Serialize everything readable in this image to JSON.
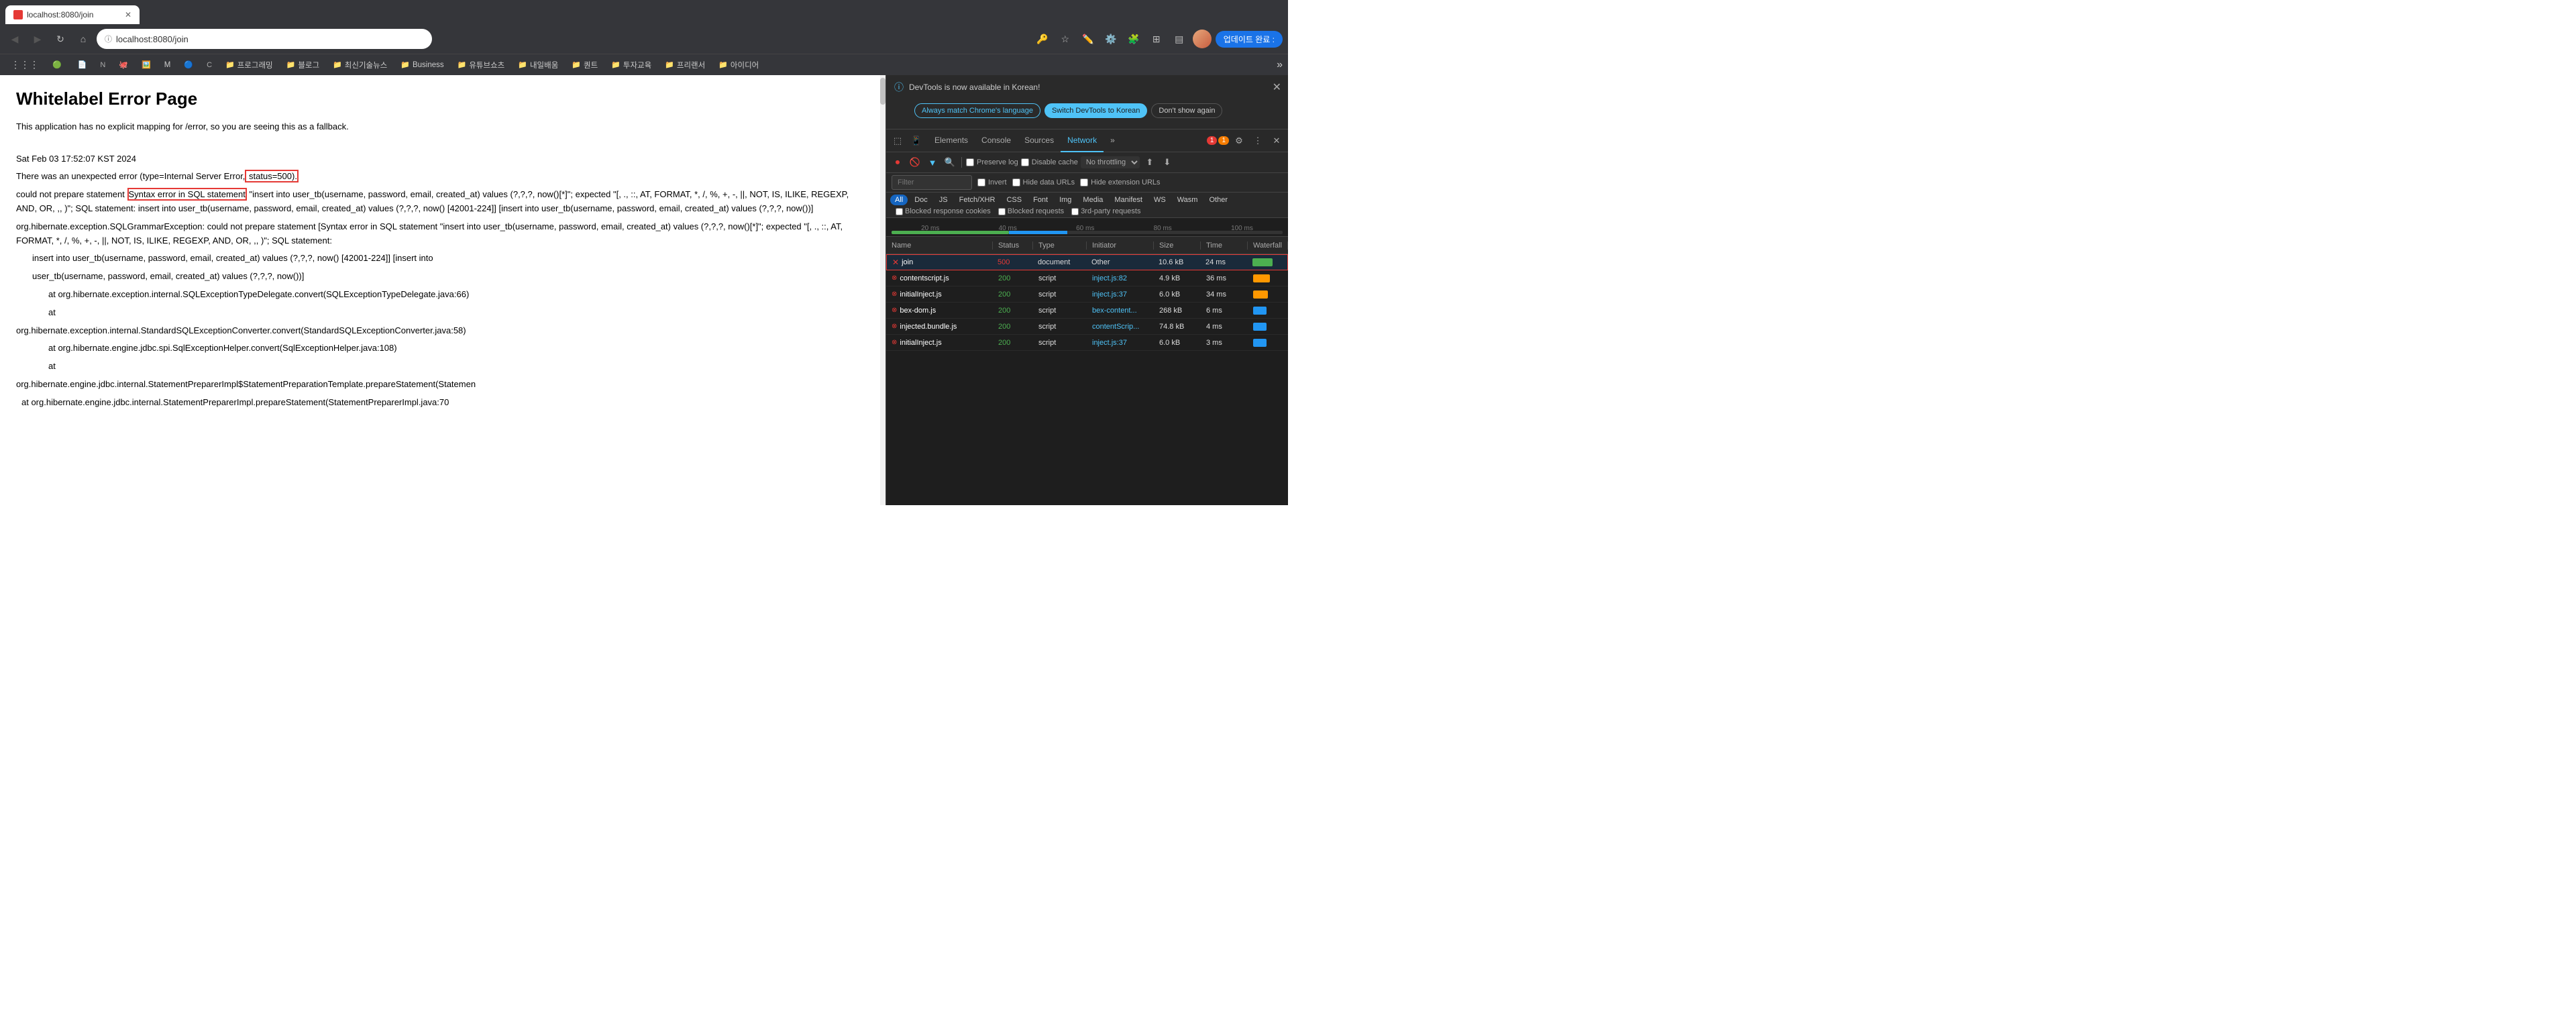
{
  "browser": {
    "address": "localhost:8080/join",
    "tab_title": "localhost:8080/join",
    "update_btn": "업데이트 완료 :",
    "nav": {
      "back": "←",
      "forward": "→",
      "reload": "↺",
      "home": "⌂"
    }
  },
  "bookmarks": [
    {
      "label": "프로그래밍",
      "icon": "📁"
    },
    {
      "label": "블로그",
      "icon": "📁"
    },
    {
      "label": "최신기술뉴스",
      "icon": "📁"
    },
    {
      "label": "Business",
      "icon": "📁"
    },
    {
      "label": "유튜브쇼츠",
      "icon": "📁"
    },
    {
      "label": "내일배움",
      "icon": "📁"
    },
    {
      "label": "퀀트",
      "icon": "📁"
    },
    {
      "label": "투자교육",
      "icon": "📁"
    },
    {
      "label": "프리랜서",
      "icon": "📁"
    },
    {
      "label": "아이디어",
      "icon": "📁"
    }
  ],
  "page": {
    "title": "Whitelabel Error Page",
    "paragraph1": "This application has no explicit mapping for /error, so you are seeing this as a fallback.",
    "line1": "Sat Feb 03 17:52:07 KST 2024",
    "line2_prefix": "There was an unexpected error (type=Internal Server Error,",
    "line2_suffix": " status=500).",
    "line3": "could not prepare statement [Syntax error in SQL statement \"insert into user_tb(username, password, email, created_at) values (?,?,?, now()[*]\"; expected \"[, ., ::, AT, FORMAT, *, /, %, +, -, ||, NOT, IS, ILIKE, REGEXP, AND, OR, ,, )\"; SQL statement: insert into user_tb(username, password, email, created_at) values (?,?,?, now() [42001-224]] [insert into user_tb(username, password, email, created_at) values (?,?,?, now())]",
    "line4": "org.hibernate.exception.SQLGrammarException: could not prepare statement [Syntax error in SQL statement \"insert into user_tb(username, password, email, created_at) values (?,?,?, now()[*]\"; expected \"[, ., ::, AT, FORMAT, *, /, %, +, -, ||, NOT, IS, ILIKE, REGEXP, AND, OR, ,, )\"; SQL statement:",
    "line5": "\tinsert into user_tb(username, password, email, created_at) values (?,?,?, now() [42001-224]] [insert into",
    "line6": "\tuser_tb(username, password, email, created_at) values (?,?,?, now())]",
    "line7": "\t\tat org.hibernate.exception.internal.SQLExceptionTypeDelegate.convert(SQLExceptionTypeDelegate.java:66)",
    "line8": "\t\tat",
    "line9": "org.hibernate.exception.internal.StandardSQLExceptionConverter.convert(StandardSQLExceptionConverter.java:58)",
    "line10": "\t\tat org.hibernate.engine.jdbc.spi.SqlExceptionHelper.convert(SqlExceptionHelper.java:108)",
    "line11": "\t\tat",
    "line12": "org.hibernate.engine.jdbc.internal.StatementPreparerImpl$StatementPreparationTemplate.prepareStatement(Statemen",
    "line13": "\tat org.hibernate.engine.jdbc.internal.StatementPreparerImpl.prepareStatement(StatementPreparerImpl.java:70"
  },
  "devtools": {
    "notification": {
      "text": "DevTools is now available in Korean!",
      "btn1": "Always match Chrome's language",
      "btn2": "Switch DevTools to Korean",
      "btn3": "Don't show again"
    },
    "tabs": [
      "Elements",
      "Console",
      "Sources",
      "Network",
      "»"
    ],
    "active_tab": "Network",
    "error_count": "1",
    "warn_count": "1",
    "toolbar": {
      "filter_placeholder": "Filter",
      "preserve_log": "Preserve log",
      "disable_cache": "Disable cache",
      "throttle": "No throttling"
    },
    "filter_buttons": [
      "All",
      "Doc",
      "JS",
      "Fetch/XHR",
      "CSS",
      "Font",
      "Img",
      "Media",
      "Manifest",
      "WS",
      "Wasm",
      "Other"
    ],
    "active_filter": "All",
    "checkboxes": {
      "blocked_cookies": "Blocked response cookies",
      "blocked_requests": "Blocked requests",
      "third_party": "3rd-party requests",
      "invert": "Invert",
      "hide_data_urls": "Hide data URLs",
      "hide_ext_urls": "Hide extension URLs"
    },
    "timeline": {
      "labels": [
        "20 ms",
        "40 ms",
        "60 ms",
        "80 ms",
        "100 ms"
      ]
    },
    "table": {
      "headers": [
        "Name",
        "Status",
        "Type",
        "Initiator",
        "Size",
        "Time",
        "Waterfall"
      ],
      "rows": [
        {
          "name": "join",
          "status": "500",
          "type": "document",
          "initiator": "Other",
          "size": "10.6 kB",
          "time": "24 ms",
          "waterfall_type": "green",
          "is_error": true,
          "selected": true
        },
        {
          "name": "contentscript.js",
          "status": "200",
          "type": "script",
          "initiator": "inject.js:82",
          "size": "4.9 kB",
          "time": "36 ms",
          "waterfall_type": "orange",
          "is_error": false,
          "selected": false
        },
        {
          "name": "initialInject.js",
          "status": "200",
          "type": "script",
          "initiator": "inject.js:37",
          "size": "6.0 kB",
          "time": "34 ms",
          "waterfall_type": "orange",
          "is_error": false,
          "selected": false
        },
        {
          "name": "bex-dom.js",
          "status": "200",
          "type": "script",
          "initiator": "bex-content...",
          "size": "268 kB",
          "time": "6 ms",
          "waterfall_type": "blue",
          "is_error": false,
          "selected": false
        },
        {
          "name": "injected.bundle.js",
          "status": "200",
          "type": "script",
          "initiator": "contentScrip...",
          "size": "74.8 kB",
          "time": "4 ms",
          "waterfall_type": "blue",
          "is_error": false,
          "selected": false
        },
        {
          "name": "initialInject.js",
          "status": "200",
          "type": "script",
          "initiator": "inject.js:37",
          "size": "6.0 kB",
          "time": "3 ms",
          "waterfall_type": "blue",
          "is_error": false,
          "selected": false
        }
      ]
    }
  }
}
